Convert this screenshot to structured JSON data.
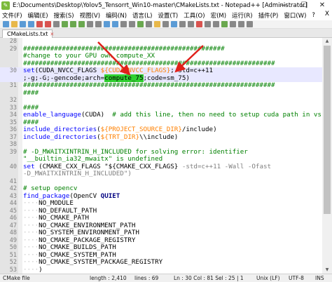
{
  "window": {
    "title": "E:\\Documents\\Desktop\\Yolov5_Tensorrt_Win10-master\\CMakeLists.txt - Notepad++ [Administrator]",
    "minimize": "—",
    "maximize": "☐",
    "close": "✕"
  },
  "menu": [
    "文件(F)",
    "编辑(E)",
    "搜索(S)",
    "视图(V)",
    "编码(N)",
    "语言(L)",
    "设置(T)",
    "工具(O)",
    "宏(M)",
    "运行(R)",
    "插件(P)",
    "窗口(W)",
    "?"
  ],
  "menu_close": "X",
  "tab": {
    "label": "CMakeLists.txt",
    "close": "✕"
  },
  "lines": [
    {
      "n": "28",
      "segs": []
    },
    {
      "n": "29",
      "segs": [
        [
          "cmt",
          "####################################################"
        ]
      ]
    },
    {
      "n": "",
      "segs": [
        [
          "cmt",
          "#change to your GPU own compute_XX"
        ]
      ]
    },
    {
      "n": "",
      "segs": [
        [
          "cmt",
          "#################################################################"
        ]
      ]
    },
    {
      "n": "30",
      "segs": [
        [
          "kw",
          "set"
        ],
        [
          "",
          "(CUDA_NVCC_FLAGS "
        ],
        [
          "var",
          "${CUDA_NVCC_FLAGS}"
        ],
        [
          "",
          ";-std=c++11"
        ]
      ]
    },
    {
      "n": "",
      "segs": [
        [
          "",
          ";-g;-G;-gencode;arch="
        ],
        [
          "sel",
          "compute_75"
        ],
        [
          "",
          ";code=sm_75)"
        ]
      ]
    },
    {
      "n": "31",
      "segs": [
        [
          "cmt",
          "#################################################################"
        ]
      ]
    },
    {
      "n": "",
      "segs": [
        [
          "cmt",
          "####"
        ]
      ]
    },
    {
      "n": "32",
      "segs": []
    },
    {
      "n": "33",
      "segs": [
        [
          "cmt",
          "####"
        ]
      ]
    },
    {
      "n": "34",
      "segs": [
        [
          "kw",
          "enable_language"
        ],
        [
          "",
          "(CUDA)  "
        ],
        [
          "cmt",
          "# add this line, then no need to setup cuda path in vs"
        ]
      ]
    },
    {
      "n": "35",
      "segs": [
        [
          "cmt",
          "####"
        ]
      ]
    },
    {
      "n": "36",
      "segs": [
        [
          "kw",
          "include_directories"
        ],
        [
          "",
          "("
        ],
        [
          "var",
          "${PROJECT_SOURCE_DIR}"
        ],
        [
          "",
          "/include)"
        ]
      ]
    },
    {
      "n": "37",
      "segs": [
        [
          "kw",
          "include_directories"
        ],
        [
          "",
          "("
        ],
        [
          "var",
          "${TRT_DIR}"
        ],
        [
          "",
          "\\\\include)"
        ]
      ]
    },
    {
      "n": "38",
      "segs": []
    },
    {
      "n": "39",
      "segs": [
        [
          "cmt",
          "# -D_MWAITXINTRIN_H_INCLUDED for solving error: identifier"
        ]
      ]
    },
    {
      "n": "",
      "segs": [
        [
          "cmt",
          "\"__builtin_ia32_mwaitx\" is undefined"
        ]
      ]
    },
    {
      "n": "40",
      "segs": [
        [
          "kw",
          "set"
        ],
        [
          "",
          " (CMAKE_CXX_FLAGS \"${CMAKE_CXX_FLAGS} "
        ],
        [
          "dim",
          "-std=c++11 -Wall -Ofast"
        ]
      ]
    },
    {
      "n": "",
      "segs": [
        [
          "dim",
          "-D_MWAITXINTRIN_H_INCLUDED\")"
        ]
      ]
    },
    {
      "n": "41",
      "segs": []
    },
    {
      "n": "42",
      "segs": [
        [
          "cmt",
          "# setup opencv"
        ]
      ]
    },
    {
      "n": "43",
      "segs": [
        [
          "kw",
          "find_package"
        ],
        [
          "",
          "(OpenCV "
        ],
        [
          "kwb",
          "QUIET"
        ]
      ]
    },
    {
      "n": "44",
      "segs": [
        [
          "dots",
          "····"
        ],
        [
          "",
          "NO_MODULE"
        ]
      ]
    },
    {
      "n": "45",
      "segs": [
        [
          "dots",
          "····"
        ],
        [
          "",
          "NO_DEFAULT_PATH"
        ]
      ]
    },
    {
      "n": "46",
      "segs": [
        [
          "dots",
          "····"
        ],
        [
          "",
          "NO_CMAKE_PATH"
        ]
      ]
    },
    {
      "n": "47",
      "segs": [
        [
          "dots",
          "····"
        ],
        [
          "",
          "NO_CMAKE_ENVIRONMENT_PATH"
        ]
      ]
    },
    {
      "n": "48",
      "segs": [
        [
          "dots",
          "····"
        ],
        [
          "",
          "NO_SYSTEM_ENVIRONMENT_PATH"
        ]
      ]
    },
    {
      "n": "49",
      "segs": [
        [
          "dots",
          "····"
        ],
        [
          "",
          "NO_CMAKE_PACKAGE_REGISTRY"
        ]
      ]
    },
    {
      "n": "50",
      "segs": [
        [
          "dots",
          "····"
        ],
        [
          "",
          "NO_CMAKE_BUILDS_PATH"
        ]
      ]
    },
    {
      "n": "51",
      "segs": [
        [
          "dots",
          "····"
        ],
        [
          "",
          "NO_CMAKE_SYSTEM_PATH"
        ]
      ]
    },
    {
      "n": "52",
      "segs": [
        [
          "dots",
          "····"
        ],
        [
          "",
          "NO_CMAKE_SYSTEM_PACKAGE_REGISTRY"
        ]
      ]
    },
    {
      "n": "53",
      "segs": [
        [
          "dots",
          "····"
        ],
        [
          "",
          ")"
        ]
      ]
    }
  ],
  "status": {
    "file_type": "CMake file",
    "length": "length : 2,410",
    "lines": "lines : 69",
    "position": "Ln : 30   Col : 81   Sel : 25 | 1",
    "eol": "Unix (LF)",
    "encoding": "UTF-8",
    "mode": "INS"
  },
  "colors": {
    "selection": "#2fd12f",
    "current_line": "#e8e8ff",
    "comment": "#008000",
    "keyword": "#0000ff",
    "variable": "#ff8000",
    "arrow": "#e0201a"
  },
  "icons": [
    "notepadpp-app-icon",
    "file-modified-icon",
    "annotation-arrow"
  ]
}
